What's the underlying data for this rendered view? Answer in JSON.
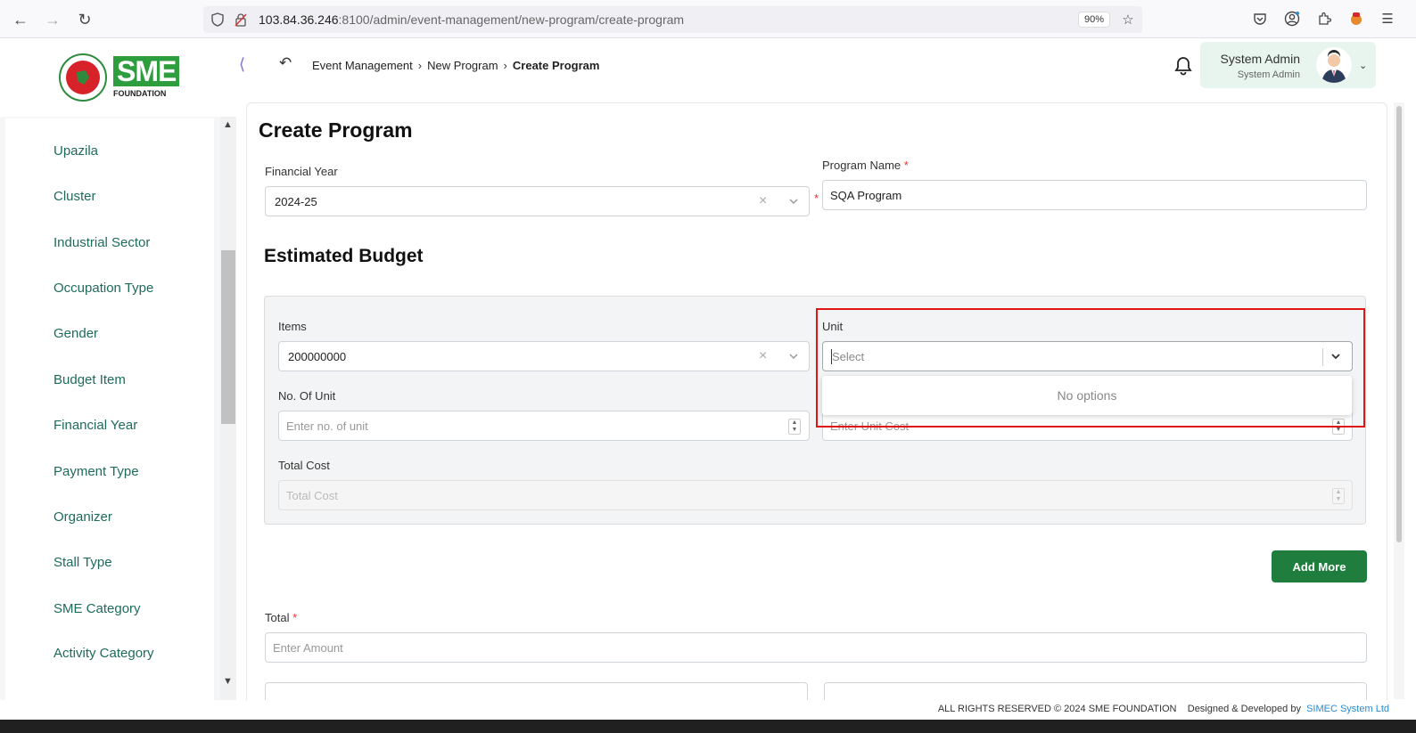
{
  "browser": {
    "url_host": "103.84.36.246",
    "url_rest": ":8100/admin/event-management/new-program/create-program",
    "zoom": "90%"
  },
  "logo": {
    "brand_short": "SME",
    "brand_word": "FOUNDATION"
  },
  "sidebar": {
    "items": [
      {
        "label": "Upazila"
      },
      {
        "label": "Cluster"
      },
      {
        "label": "Industrial Sector"
      },
      {
        "label": "Occupation Type"
      },
      {
        "label": "Gender"
      },
      {
        "label": "Budget Item"
      },
      {
        "label": "Financial Year"
      },
      {
        "label": "Payment Type"
      },
      {
        "label": "Organizer"
      },
      {
        "label": "Stall Type"
      },
      {
        "label": "SME Category"
      },
      {
        "label": "Activity Category"
      }
    ]
  },
  "breadcrumb": {
    "items": [
      "Event Management",
      "New Program",
      "Create Program"
    ]
  },
  "user": {
    "name": "System Admin",
    "role": "System Admin"
  },
  "form": {
    "title": "Create Program",
    "financial_year_label": "Financial Year",
    "financial_year_value": "2024-25",
    "program_name_label": "Program Name",
    "program_name_value": "SQA Program",
    "required_mark": "*",
    "budget_title": "Estimated Budget",
    "items_label": "Items",
    "items_value": "200000000",
    "unit_label": "Unit",
    "unit_placeholder": "Select",
    "unit_dropdown_message": "No options",
    "no_of_unit_label": "No. Of Unit",
    "no_of_unit_placeholder": "Enter no. of unit",
    "unit_cost_placeholder": "Enter Unit Cost",
    "total_cost_label": "Total Cost",
    "total_cost_placeholder": "Total Cost",
    "add_more_label": "Add More",
    "total_label": "Total",
    "total_placeholder": "Enter Amount"
  },
  "footer": {
    "rights": "ALL RIGHTS RESERVED © 2024 SME FOUNDATION",
    "designed_by": "Designed & Developed by",
    "company": "SIMEC System Ltd"
  },
  "colors": {
    "sidebar_text": "#1e6b5c",
    "primary_button": "#1f7d3d",
    "highlight_border": "#e01616",
    "user_box_bg": "#e8f5ee"
  }
}
